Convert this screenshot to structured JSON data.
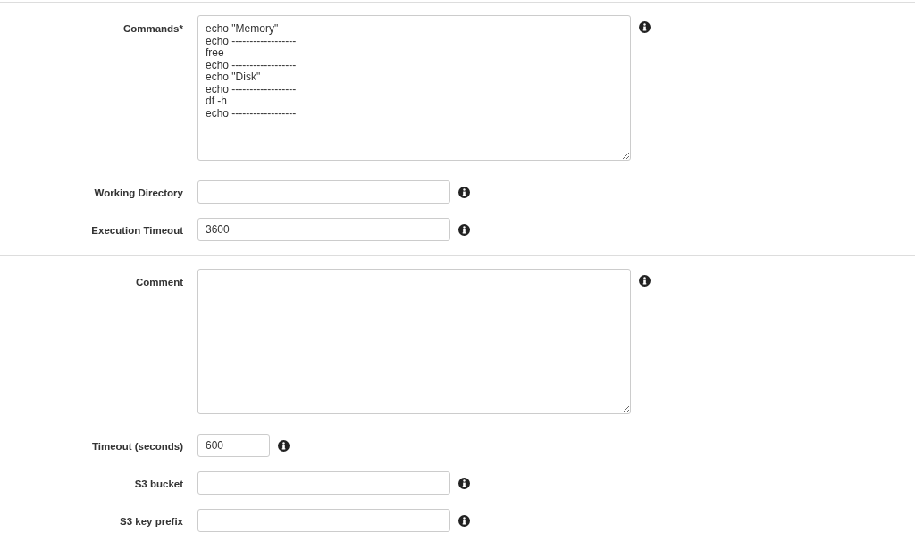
{
  "sections": [
    {
      "fields": [
        {
          "label": "Commands*",
          "kind": "textarea",
          "value": "echo \"Memory\"\necho ------------------\nfree\necho ------------------\necho \"Disk\"\necho ------------------\ndf -h\necho ------------------"
        },
        {
          "label": "Working Directory",
          "kind": "input"
        },
        {
          "label": "Execution Timeout",
          "kind": "input",
          "value": "3600"
        }
      ]
    },
    {
      "fields": [
        {
          "label": "Comment",
          "kind": "textarea"
        },
        {
          "label": "Timeout (seconds)",
          "kind": "shortinput",
          "value": "600"
        },
        {
          "label": "S3 bucket",
          "kind": "input"
        },
        {
          "label": "S3 key prefix",
          "kind": "input"
        }
      ]
    }
  ]
}
